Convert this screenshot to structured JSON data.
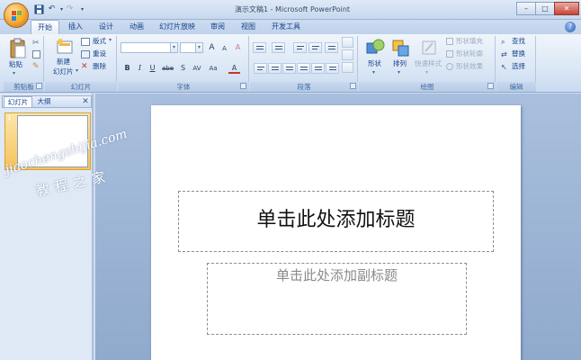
{
  "window": {
    "title": "演示文稿1 - Microsoft PowerPoint",
    "buttons": {
      "minimize": "–",
      "maximize": "□",
      "close": "✕"
    }
  },
  "qat": {
    "save": "save-icon",
    "undo": "undo-icon",
    "redo": "redo-icon"
  },
  "tabs": [
    {
      "label": "开始",
      "active": true
    },
    {
      "label": "插入"
    },
    {
      "label": "设计"
    },
    {
      "label": "动画"
    },
    {
      "label": "幻灯片放映"
    },
    {
      "label": "审阅"
    },
    {
      "label": "视图"
    },
    {
      "label": "开发工具"
    }
  ],
  "help": "?",
  "ribbon": {
    "clipboard": {
      "paste": "粘贴",
      "group_label": "剪贴板"
    },
    "slides": {
      "new_slide_line1": "新建",
      "new_slide_line2": "幻灯片",
      "layout": "版式",
      "reset": "重设",
      "delete": "删除",
      "group_label": "幻灯片"
    },
    "font": {
      "grow": "A",
      "shrink": "A",
      "clear": "A",
      "bold": "B",
      "italic": "I",
      "underline": "U",
      "strike": "abe",
      "shadow": "S",
      "spacing": "AV",
      "case": "Aa",
      "color": "A",
      "group_label": "字体"
    },
    "paragraph": {
      "group_label": "段落"
    },
    "drawing": {
      "shapes": "形状",
      "arrange": "排列",
      "quick_styles": "快速样式",
      "shape_fill": "形状填充",
      "shape_outline": "形状轮廓",
      "shape_effects": "形状效果",
      "group_label": "绘图"
    },
    "editing": {
      "find": "查找",
      "replace": "替换",
      "select": "选择",
      "group_label": "编辑"
    }
  },
  "left_pane": {
    "tab_slides": "幻灯片",
    "tab_outline": "大纲",
    "close": "✕",
    "slide_number": "1"
  },
  "slide": {
    "title_placeholder": "单击此处添加标题",
    "subtitle_placeholder": "单击此处添加副标题"
  },
  "watermark": {
    "line1": "jiaochengzhijia.com",
    "line2": "教程之家"
  }
}
